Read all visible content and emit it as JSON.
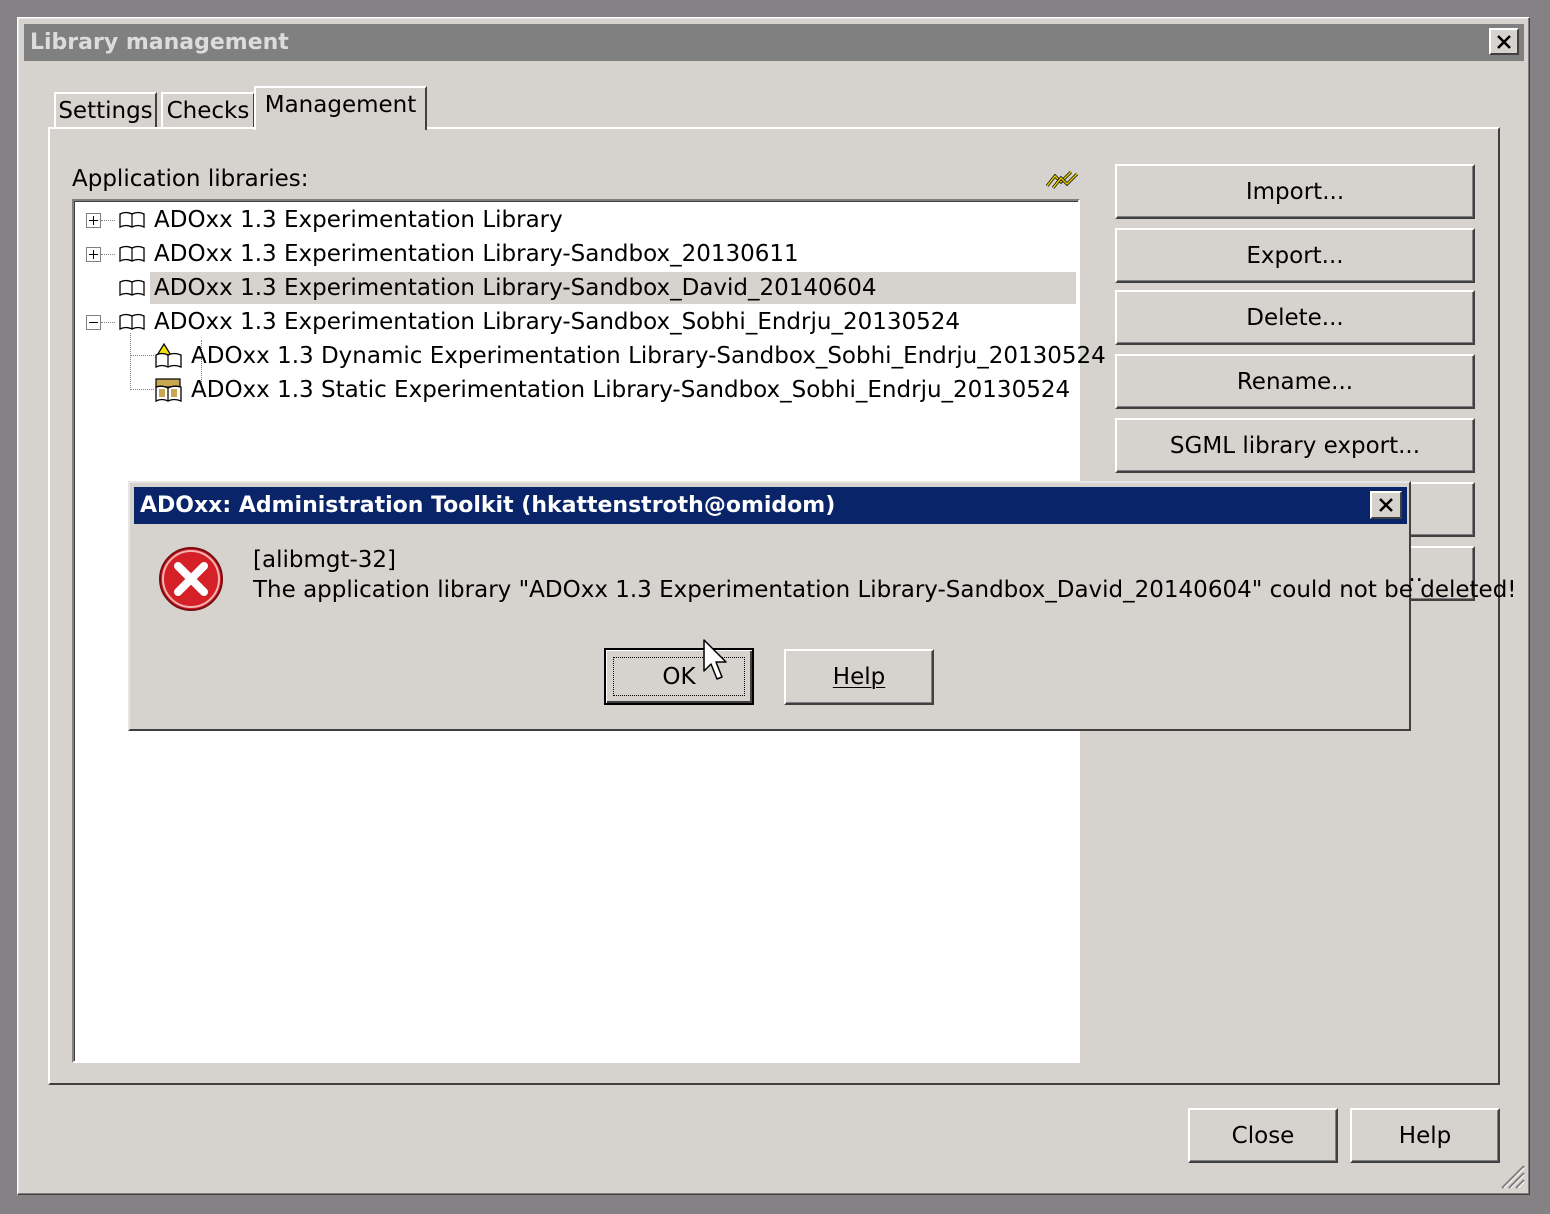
{
  "window": {
    "title": "Library management",
    "tabs": [
      {
        "label": "Settings",
        "active": false
      },
      {
        "label": "Checks",
        "active": false
      },
      {
        "label": "Management",
        "active": true
      }
    ],
    "section_label": "Application libraries:",
    "tree": [
      {
        "label": "ADOxx 1.3 Experimentation Library",
        "expander": "plus",
        "icon": "book-icon",
        "selected": false,
        "level": 0
      },
      {
        "label": "ADOxx 1.3 Experimentation Library-Sandbox_20130611",
        "expander": "plus",
        "icon": "book-icon",
        "selected": false,
        "level": 0
      },
      {
        "label": "ADOxx 1.3 Experimentation Library-Sandbox_David_20140604",
        "expander": "none",
        "icon": "book-icon",
        "selected": true,
        "level": 0
      },
      {
        "label": "ADOxx 1.3 Experimentation Library-Sandbox_Sobhi_Endrju_20130524",
        "expander": "minus",
        "icon": "book-icon",
        "selected": false,
        "level": 0
      },
      {
        "label": "ADOxx 1.3 Dynamic Experimentation Library-Sandbox_Sobhi_Endrju_20130524",
        "expander": "none",
        "icon": "dynamic-library-icon",
        "selected": false,
        "level": 1
      },
      {
        "label": "ADOxx 1.3 Static Experimentation Library-Sandbox_Sobhi_Endrju_20130524",
        "expander": "none",
        "icon": "static-library-icon",
        "selected": false,
        "level": 1
      }
    ],
    "side_buttons": [
      "Import...",
      "Export...",
      "Delete...",
      "Rename...",
      "SGML library export...",
      "",
      "..."
    ],
    "footer": {
      "close_label": "Close",
      "help_label": "Help"
    }
  },
  "dialog": {
    "title": "ADOxx: Administration Toolkit (hkattenstroth@omidom)",
    "code": "[alibmgt-32]",
    "message": "The application library \"ADOxx 1.3 Experimentation Library-Sandbox_David_20140604\" could not be deleted!",
    "ok_label": "OK",
    "help_label": "Help",
    "help_mnemonic": "H"
  },
  "colors": {
    "dialog_titlebar": "#0a246a",
    "inactive_titlebar": "#808080",
    "face": "#d6d3ce",
    "error_red": "#d42027"
  }
}
